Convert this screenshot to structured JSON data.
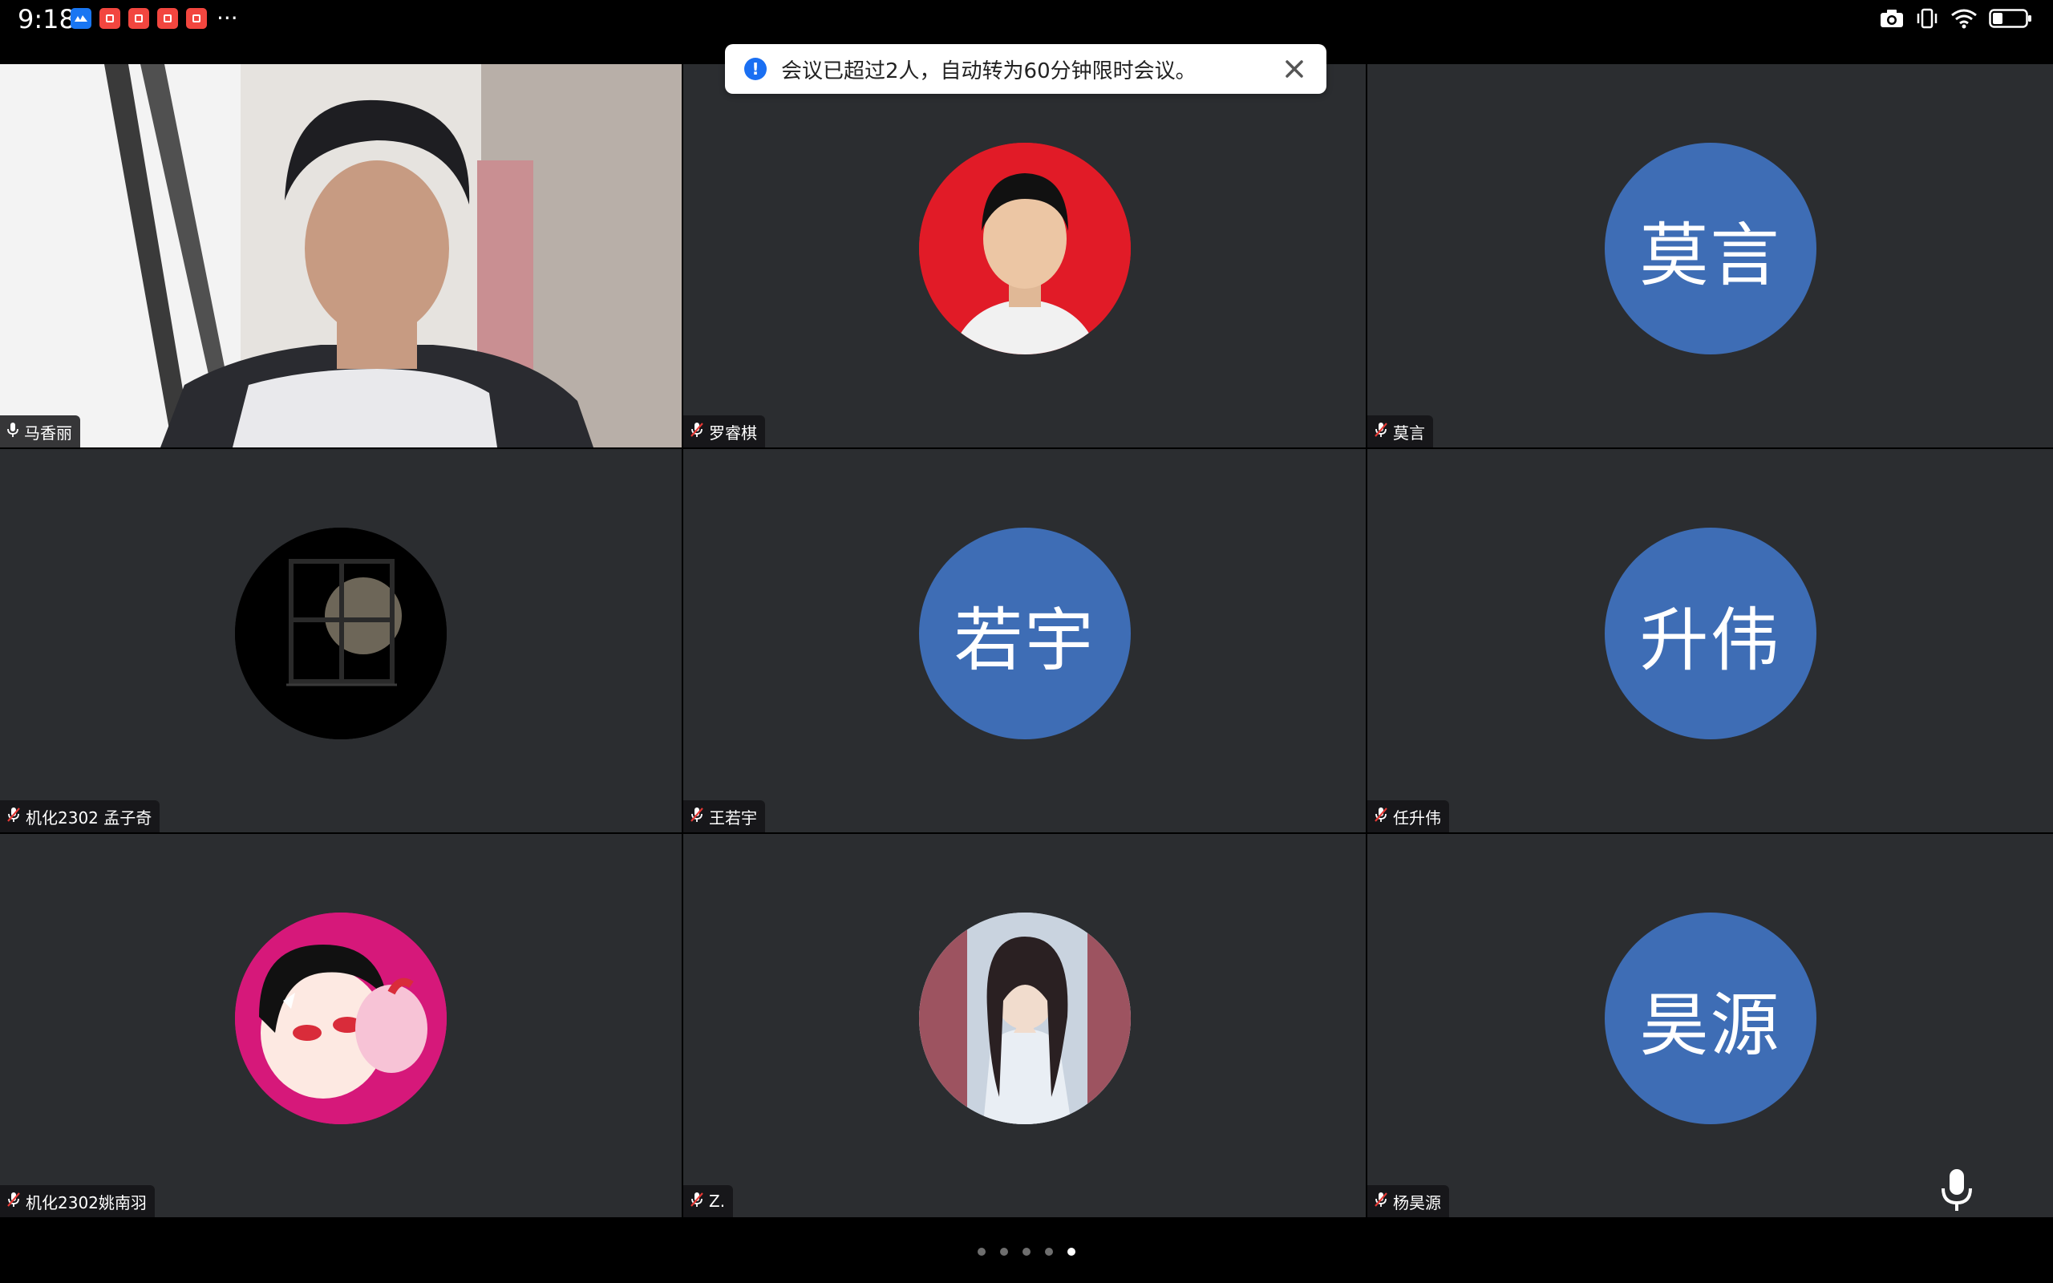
{
  "status_bar": {
    "time": "9:18",
    "notification_icons": [
      {
        "name": "cloud-app-icon",
        "color": "#1976f2"
      },
      {
        "name": "red-app-icon",
        "color": "#f2463f"
      },
      {
        "name": "red-app-icon",
        "color": "#f2463f"
      },
      {
        "name": "red-app-icon",
        "color": "#f2463f"
      },
      {
        "name": "red-app-icon",
        "color": "#f2463f"
      }
    ],
    "more": "···",
    "right_icons": [
      "camera-icon",
      "vibrate-icon",
      "wifi-icon",
      "battery-icon"
    ]
  },
  "toast": {
    "message": "会议已超过2人，自动转为60分钟限时会议。",
    "icon": "info-icon",
    "close_icon": "close-icon"
  },
  "participants": [
    {
      "name": "马香丽",
      "avatar_type": "camera",
      "muted": false
    },
    {
      "name": "罗睿棋",
      "avatar_type": "photo",
      "avatar_bg": "#e11b27",
      "muted": true
    },
    {
      "name": "莫言",
      "avatar_type": "text",
      "avatar_text": "莫言",
      "muted": true
    },
    {
      "name": "机化2302 孟子奇",
      "avatar_type": "photo",
      "avatar_bg": "#000000",
      "muted": true
    },
    {
      "name": "王若宇",
      "avatar_type": "text",
      "avatar_text": "若宇",
      "muted": true
    },
    {
      "name": "任升伟",
      "avatar_type": "text",
      "avatar_text": "升伟",
      "muted": true
    },
    {
      "name": "机化2302姚南羽",
      "avatar_type": "photo",
      "avatar_bg": "#d6187a",
      "muted": true
    },
    {
      "name": "Z.",
      "avatar_type": "photo",
      "avatar_bg": "#c9d3df",
      "muted": true
    },
    {
      "name": "杨昊源",
      "avatar_type": "text",
      "avatar_text": "昊源",
      "muted": true
    }
  ],
  "colors": {
    "tile_bg": "#2b2d30",
    "text_avatar_bg": "#3e6db5",
    "muted_mic": "#e53935"
  },
  "pagination": {
    "total": 5,
    "active_index": 4
  },
  "mic_button_icon": "microphone-icon"
}
